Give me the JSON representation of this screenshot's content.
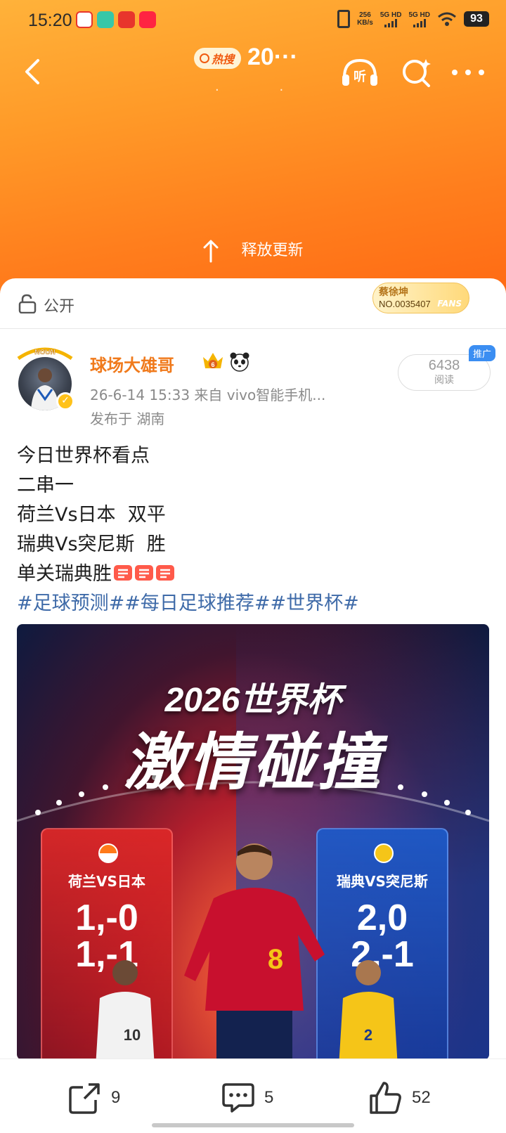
{
  "status_bar": {
    "time": "15:20",
    "net_speed_value": "256",
    "net_speed_unit": "KB/s",
    "sim1": "5G HD",
    "sim2": "5G HD",
    "battery": "93"
  },
  "header": {
    "hot_label": "热搜",
    "hot_number": "20···",
    "release_text": "释放更新"
  },
  "visibility": {
    "label": "公开"
  },
  "fans_badge": {
    "name": "蔡徐坤",
    "number": "NO.0035407",
    "word": "FANS"
  },
  "post": {
    "username": "球场大雄哥",
    "avatar_frame_text": "NOUN",
    "timestamp_source": "26-6-14 15:33  来自 vivo智能手机...",
    "location": "发布于 湖南",
    "reads_count": "6438",
    "reads_label": "阅读",
    "promo_tag": "推广",
    "lines": [
      "今日世界杯看点",
      "二串一",
      "荷兰Vs日本  双平",
      "瑞典Vs突尼斯  胜",
      "单关瑞典胜"
    ],
    "hashtags": "#足球预测##每日足球推荐##世界杯#"
  },
  "poster": {
    "title_line1": "2026世界杯",
    "title_line2": "激情碰撞",
    "left_card": {
      "match": "荷兰VS日本",
      "score1": "1,-0",
      "score2": "1,-1",
      "color": "#d62a2a"
    },
    "right_card": {
      "match": "瑞典VS突尼斯",
      "score1": "2,0",
      "score2": "2,-1",
      "color": "#1e5ac8"
    },
    "main_player_number": "8",
    "left_player_number": "10",
    "right_player_number": "2"
  },
  "actions": {
    "share_count": "9",
    "comment_count": "5",
    "like_count": "52"
  },
  "colors": {
    "header_orange": "#ff8a22",
    "username_orange": "#f07a1c",
    "hashtag_blue": "#3e6aa8",
    "promo_blue": "#3b8ef2"
  }
}
